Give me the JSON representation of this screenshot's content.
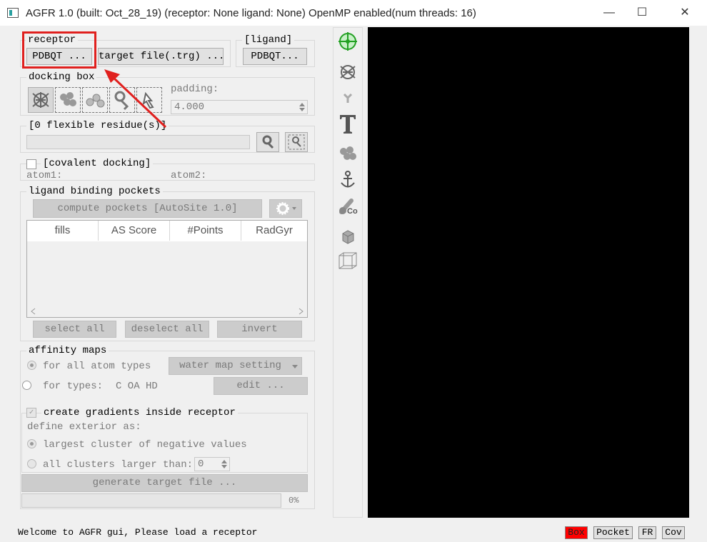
{
  "window": {
    "title": "AGFR 1.0 (built: Oct_28_19) (receptor: None ligand: None) OpenMP enabled(num threads: 16)",
    "minimize_glyph": "—",
    "maximize_glyph": "☐",
    "close_glyph": "✕"
  },
  "receptor": {
    "label": "receptor",
    "pdbqt_button": "PDBQT ...",
    "target_file_button": "target file(.trg) ..."
  },
  "ligand": {
    "label": "[ligand]",
    "pdbqt_button": "PDBQT..."
  },
  "docking_box": {
    "label": "docking box",
    "padding_label": "padding:",
    "padding_value": "4.000",
    "icons": [
      "box-receptor-icon",
      "box-ligand-icon",
      "box-atoms-icon",
      "box-residue-icon",
      "box-cursor-icon"
    ]
  },
  "flexible": {
    "label": "[0 flexible residue(s)]",
    "value": ""
  },
  "covalent": {
    "label": "[covalent docking]",
    "atom1_label": "atom1:",
    "atom2_label": "atom2:"
  },
  "pockets": {
    "label": "ligand binding pockets",
    "compute_button": "compute pockets [AutoSite 1.0]",
    "columns": [
      "fills",
      "AS Score",
      "#Points",
      "RadGyr"
    ],
    "select_all": "select all",
    "deselect_all": "deselect all",
    "invert": "invert"
  },
  "affinity": {
    "label": "affinity maps",
    "all_types_label": "for all atom types",
    "water_map_button": "water map setting",
    "for_types_label": "for types:",
    "types_value": "C OA HD",
    "edit_button": "edit ..."
  },
  "gradients": {
    "label": "create gradients inside receptor",
    "define_label": "define exterior as:",
    "option_largest": "largest cluster of negative values",
    "option_all": "all clusters larger than:",
    "cluster_value": "0"
  },
  "generate_button": "generate target file ...",
  "progress": {
    "percent_text": "0%",
    "fraction": 0
  },
  "status": {
    "message": "Welcome to AGFR gui, Please load a receptor",
    "box": "Box",
    "pocket": "Pocket",
    "fr": "FR",
    "cov": "Cov"
  },
  "colors": {
    "accent_red": "#e0201e",
    "viewer_bg": "#000000",
    "box_status_bg": "#ff0000"
  }
}
